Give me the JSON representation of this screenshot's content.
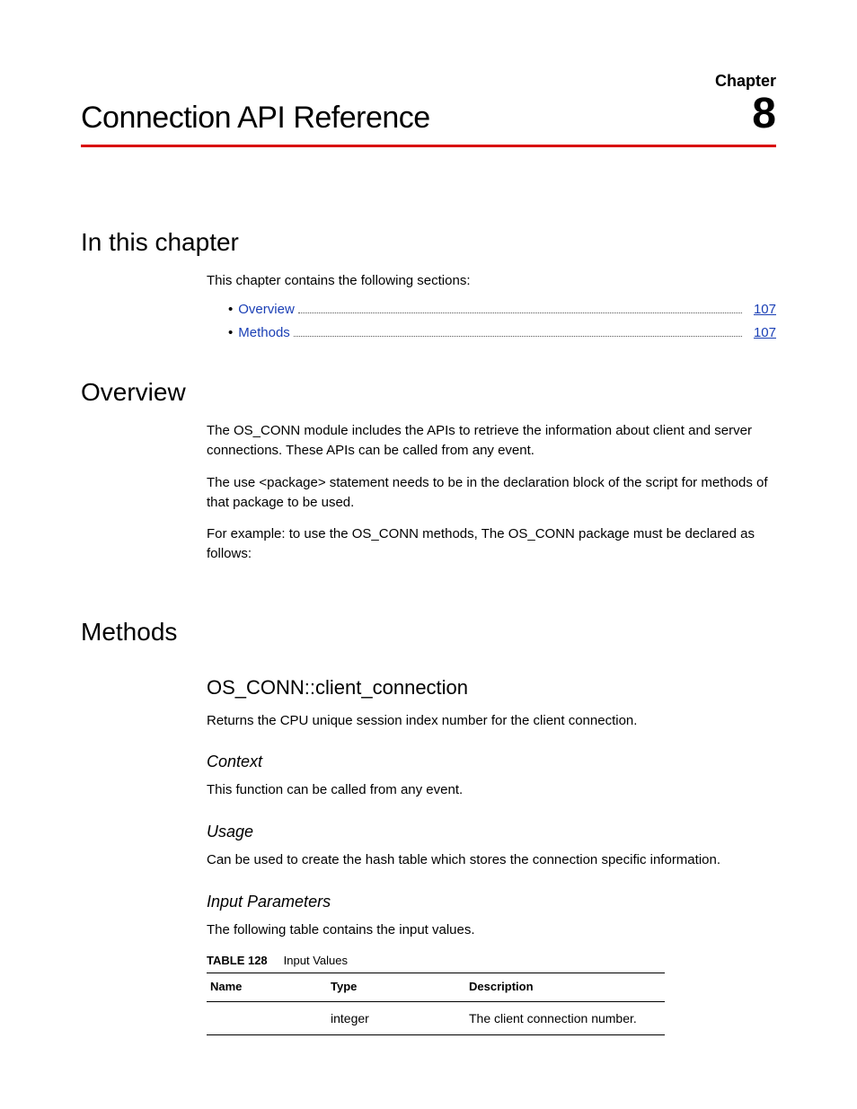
{
  "header": {
    "chapter_label": "Chapter",
    "title": "Connection API Reference",
    "chapter_number": "8"
  },
  "sections": {
    "in_this_chapter": {
      "heading": "In this chapter",
      "intro": "This chapter contains the following sections:",
      "toc": [
        {
          "label": "Overview",
          "page": "107"
        },
        {
          "label": "Methods",
          "page": "107"
        }
      ]
    },
    "overview": {
      "heading": "Overview",
      "paragraphs": [
        "The OS_CONN module includes the APIs to retrieve the information about client and server connections. These APIs can be called from any event.",
        "The use <package> statement needs to be in the declaration block of the script for methods of that package to be used.",
        "For example: to use the OS_CONN methods, The OS_CONN package must be declared as follows:"
      ]
    },
    "methods": {
      "heading": "Methods",
      "subsection": {
        "heading": "OS_CONN::client_connection",
        "desc": "Returns the CPU unique session index number for the client connection.",
        "context": {
          "heading": "Context",
          "text": "This function can be called from any event."
        },
        "usage": {
          "heading": "Usage",
          "text": "Can be used to create the hash table which stores the connection specific information."
        },
        "input_params": {
          "heading": "Input Parameters",
          "intro": "The following table contains the input values.",
          "table_label": "TABLE 128",
          "table_title": "Input Values",
          "columns": [
            "Name",
            "Type",
            "Description"
          ],
          "rows": [
            {
              "name": "",
              "type": "integer",
              "description": "The client connection number."
            }
          ]
        }
      }
    }
  }
}
